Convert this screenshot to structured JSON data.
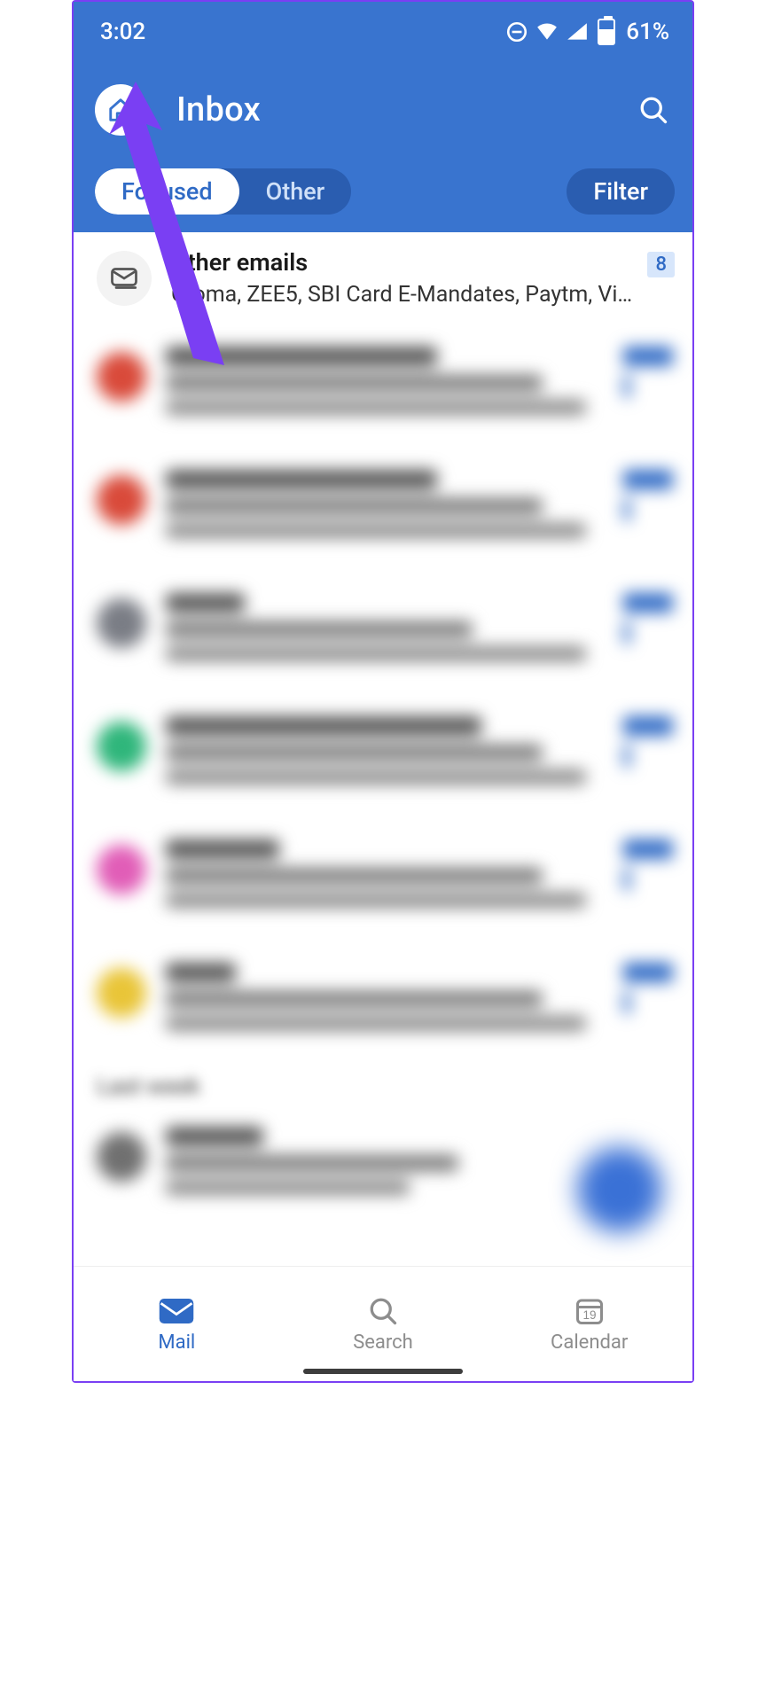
{
  "status": {
    "time": "3:02",
    "battery_text": "61%"
  },
  "header": {
    "title": "Inbox"
  },
  "tabs": {
    "focused": "Focused",
    "other": "Other",
    "filter": "Filter"
  },
  "other_emails": {
    "title": "Other emails",
    "subtitle": "Croma, ZEE5, SBI Card E-Mandates, Paytm, Vist…",
    "count": "8"
  },
  "email_avatars": {
    "c0": "#d94a3a",
    "c1": "#d94a3a",
    "c2": "#7a7d85",
    "c3": "#2fb67b",
    "c4": "#e15db7",
    "c5": "#e9c538",
    "c6": "#707070"
  },
  "section": {
    "label": "Last week"
  },
  "nav": {
    "mail": "Mail",
    "search": "Search",
    "calendar": "Calendar",
    "calendar_day": "19"
  }
}
